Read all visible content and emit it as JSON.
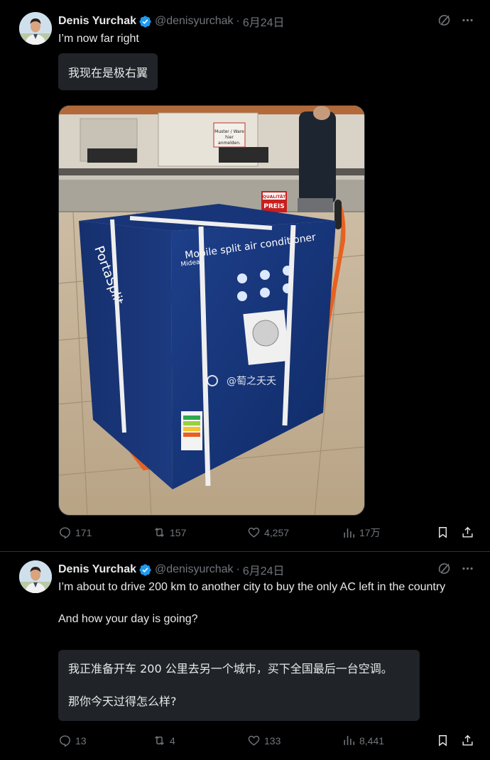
{
  "tweets": [
    {
      "author_name": "Denis Yurchak",
      "handle": "@denisyurchak",
      "separator": "·",
      "date": "6月24日",
      "text": "I’m now far right",
      "translation": "我现在是极右翼",
      "media": {
        "watermark": "@萄之夭夭",
        "box_brand": "Midea",
        "box_title": "Mobile split air conditioner",
        "box_product": "PortaSplit",
        "sign_price_top": "QUALITÄT",
        "sign_price_bottom": "PREIS",
        "counter_notice": [
          "Muster / Ware",
          "hier",
          "anmelden."
        ]
      },
      "stats": {
        "replies": "171",
        "retweets": "157",
        "likes": "4,257",
        "views": "17万"
      }
    },
    {
      "author_name": "Denis Yurchak",
      "handle": "@denisyurchak",
      "separator": "·",
      "date": "6月24日",
      "text_line1": "I’m about to drive 200 km to another city to buy the only AC left in the country",
      "text_line2": "And how your day is going?",
      "translation_line1": "我正准备开车 200 公里去另一个城市，买下全国最后一台空调。",
      "translation_line2": "那你今天过得怎么样?",
      "stats": {
        "replies": "13",
        "retweets": "4",
        "likes": "133",
        "views": "8,441"
      }
    }
  ],
  "colors": {
    "background": "#000000",
    "text": "#e7e9ea",
    "muted": "#71767b",
    "verified": "#1d9bf0",
    "translation_bg": "#202327",
    "divider": "#2f3336"
  },
  "icons": [
    "verified-badge-icon",
    "grok-icon",
    "more-icon",
    "reply-icon",
    "retweet-icon",
    "like-icon",
    "views-icon",
    "bookmark-icon",
    "share-icon"
  ]
}
